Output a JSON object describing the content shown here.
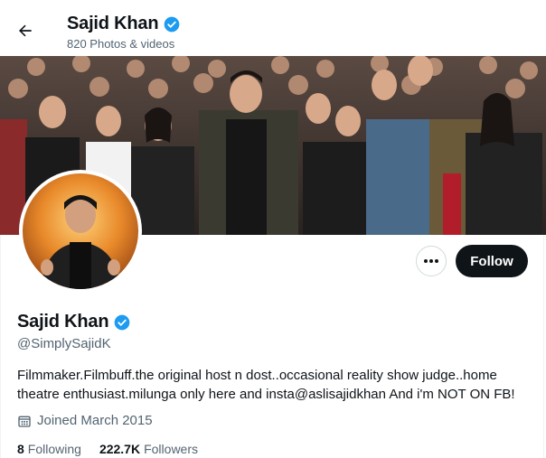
{
  "header": {
    "name": "Sajid Khan",
    "subtitle": "820 Photos & videos"
  },
  "profile": {
    "name": "Sajid Khan",
    "handle": "@SimplySajidK",
    "bio": "Filmmaker.Filmbuff.the original host n dost..occasional reality show judge..home theatre enthusiast.milunga only here and insta@aslisajidkhan And i'm NOT ON FB!",
    "joined": "Joined March 2015",
    "following_count": "8",
    "following_label": "Following",
    "followers_count": "222.7K",
    "followers_label": "Followers"
  },
  "buttons": {
    "follow": "Follow"
  },
  "colors": {
    "verified": "#1d9bf0",
    "follow_bg": "#0f1419",
    "muted_text": "#536471"
  },
  "icons": [
    "back-arrow-icon",
    "verified-badge-icon",
    "more-icon",
    "calendar-icon"
  ]
}
